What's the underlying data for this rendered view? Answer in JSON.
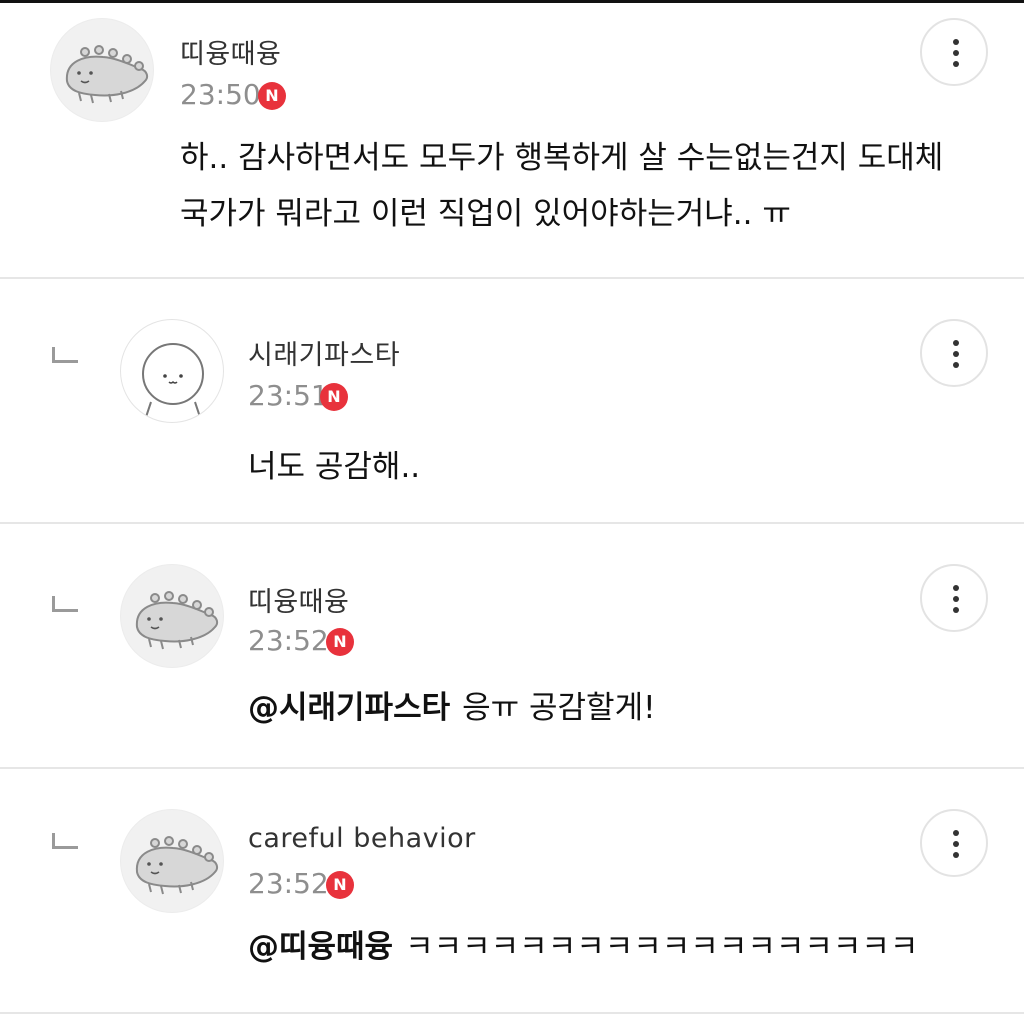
{
  "comments": [
    {
      "nickname": "띠융때융",
      "time": "23:50",
      "badge": "N",
      "avatar_icon": "dinosaur-avatar",
      "lines": [
        "하.. 감사하면서도 모두가 행복하게 살 수는없는건지 도대체",
        "국가가 뭐라고 이런 직업이 있어야하는거냐.. ㅠ"
      ]
    },
    {
      "nickname": "시래기파스타",
      "time": "23:51",
      "badge": "N",
      "avatar_icon": "round-face-avatar",
      "text": "너도 공감해.."
    },
    {
      "nickname": "띠융때융",
      "time": "23:52",
      "badge": "N",
      "avatar_icon": "dinosaur-avatar",
      "mention": "@시래기파스타",
      "text": "응ㅠ 공감할게!"
    },
    {
      "nickname": "careful behavior",
      "time": "23:52",
      "badge": "N",
      "avatar_icon": "dinosaur-avatar",
      "mention": "@띠융때융",
      "text": "ㅋㅋㅋㅋㅋㅋㅋㅋㅋㅋㅋㅋㅋㅋㅋㅋㅋㅋ"
    }
  ],
  "colors": {
    "badge": "#e8323c",
    "divider": "#e6e6e6",
    "time": "#8e8e8e"
  },
  "icons": {
    "more": "vertical-ellipsis-icon",
    "reply": "reply-corner-icon"
  }
}
